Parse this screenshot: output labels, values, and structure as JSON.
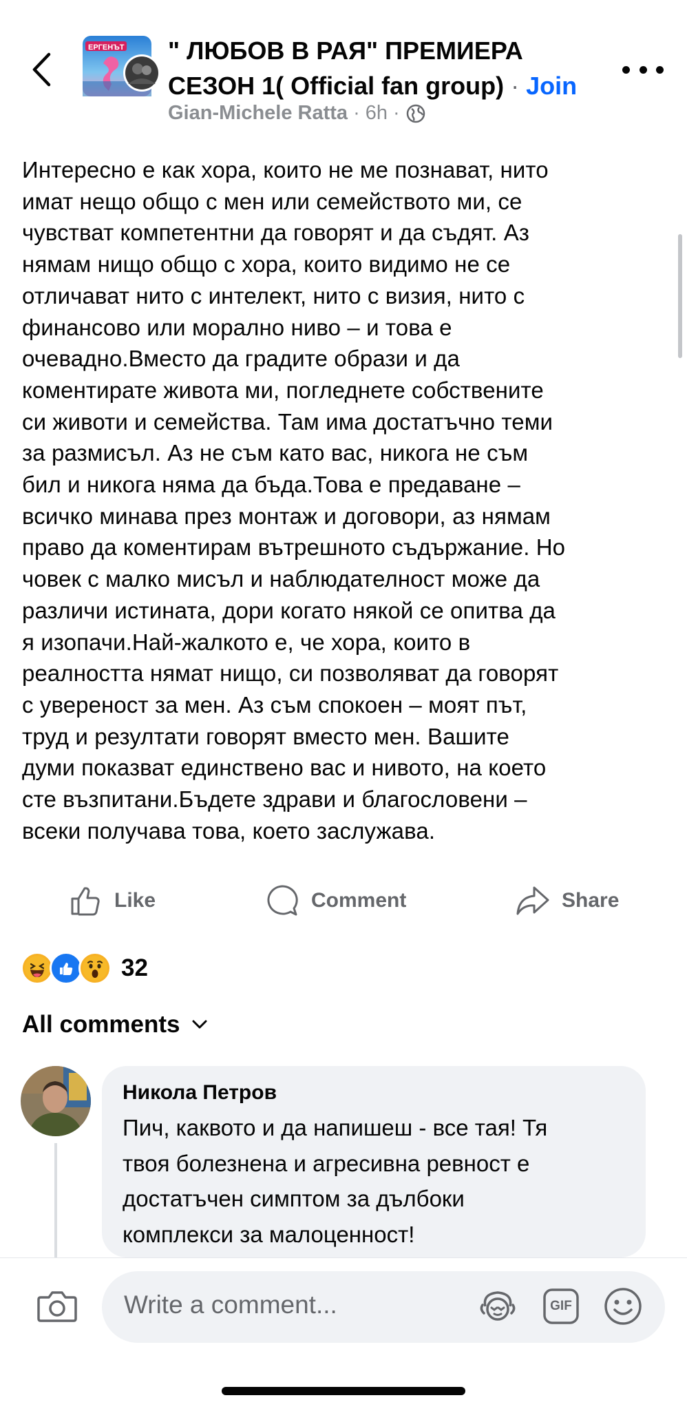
{
  "header": {
    "title_line1": "\" ЛЮБОВ В РАЯ\" ПРЕМИЕРА",
    "title_line2": "СЕЗОН 1( Official fan group)",
    "separator": "·",
    "join_label": "Join",
    "author": "Gian-Michele Ratta",
    "time": "6h",
    "meta_separator": "·",
    "privacy_icon": "globe-icon",
    "avatar_label": "ЕРГЕНЪТ"
  },
  "post": {
    "lines": [
      "Интересно е как хора, които не ме познават, нито",
      "имат нещо общо с мен или семейството ми, се",
      "чувстват компетентни да говорят и да съдят. Аз",
      "нямам нищо общо с хора, които видимо не се",
      "отличават нито с интелект, нито с визия, нито с",
      "финансово или морално ниво – и това е",
      "очевадно.Вместо да градите образи и да",
      "коментирате живота ми, погледнете собствените",
      "си животи и семейства. Там има достатъчно теми",
      "за размисъл. Аз не съм като вас, никога не съм",
      "бил и никога няма да бъда.Това е предаване –",
      "всичко минава през монтаж и договори, аз нямам",
      "право да коментирам вътрешното съдържание. Но",
      "човек с малко мисъл и наблюдателност може да",
      "различи истината, дори когато някой се опитва да",
      "я изопачи.Най-жалкото е, че хора, които в",
      "реалността нямат нищо, си позволяват да говорят",
      "с увереност за мен. Аз съм спокоен – моят път,",
      "труд и резултати говорят вместо мен. Вашите",
      "думи показват единствено вас и нивото, на което",
      "сте възпитани.Бъдете здрави и благословени –",
      "всеки получава това, което заслужава."
    ]
  },
  "actions": {
    "like_label": "Like",
    "comment_label": "Comment",
    "share_label": "Share"
  },
  "reactions": {
    "icons": [
      "haha-icon",
      "like-icon",
      "wow-icon"
    ],
    "count": "32"
  },
  "comments_section": {
    "filter_label": "All comments"
  },
  "comment": {
    "author": "Никола Петров",
    "lines": [
      "Пич, каквото и да напишеш - все тая! Тя",
      "твоя болезнена и агресивна ревност е",
      "достатъчен симптом за дълбоки",
      "комплекси за малоценност!"
    ]
  },
  "composer": {
    "placeholder": "Write a comment...",
    "gif_label": "GIF"
  },
  "colors": {
    "accent": "#0866ff",
    "text": "#050505",
    "secondary": "#65676b",
    "bubble": "#f0f2f5"
  }
}
